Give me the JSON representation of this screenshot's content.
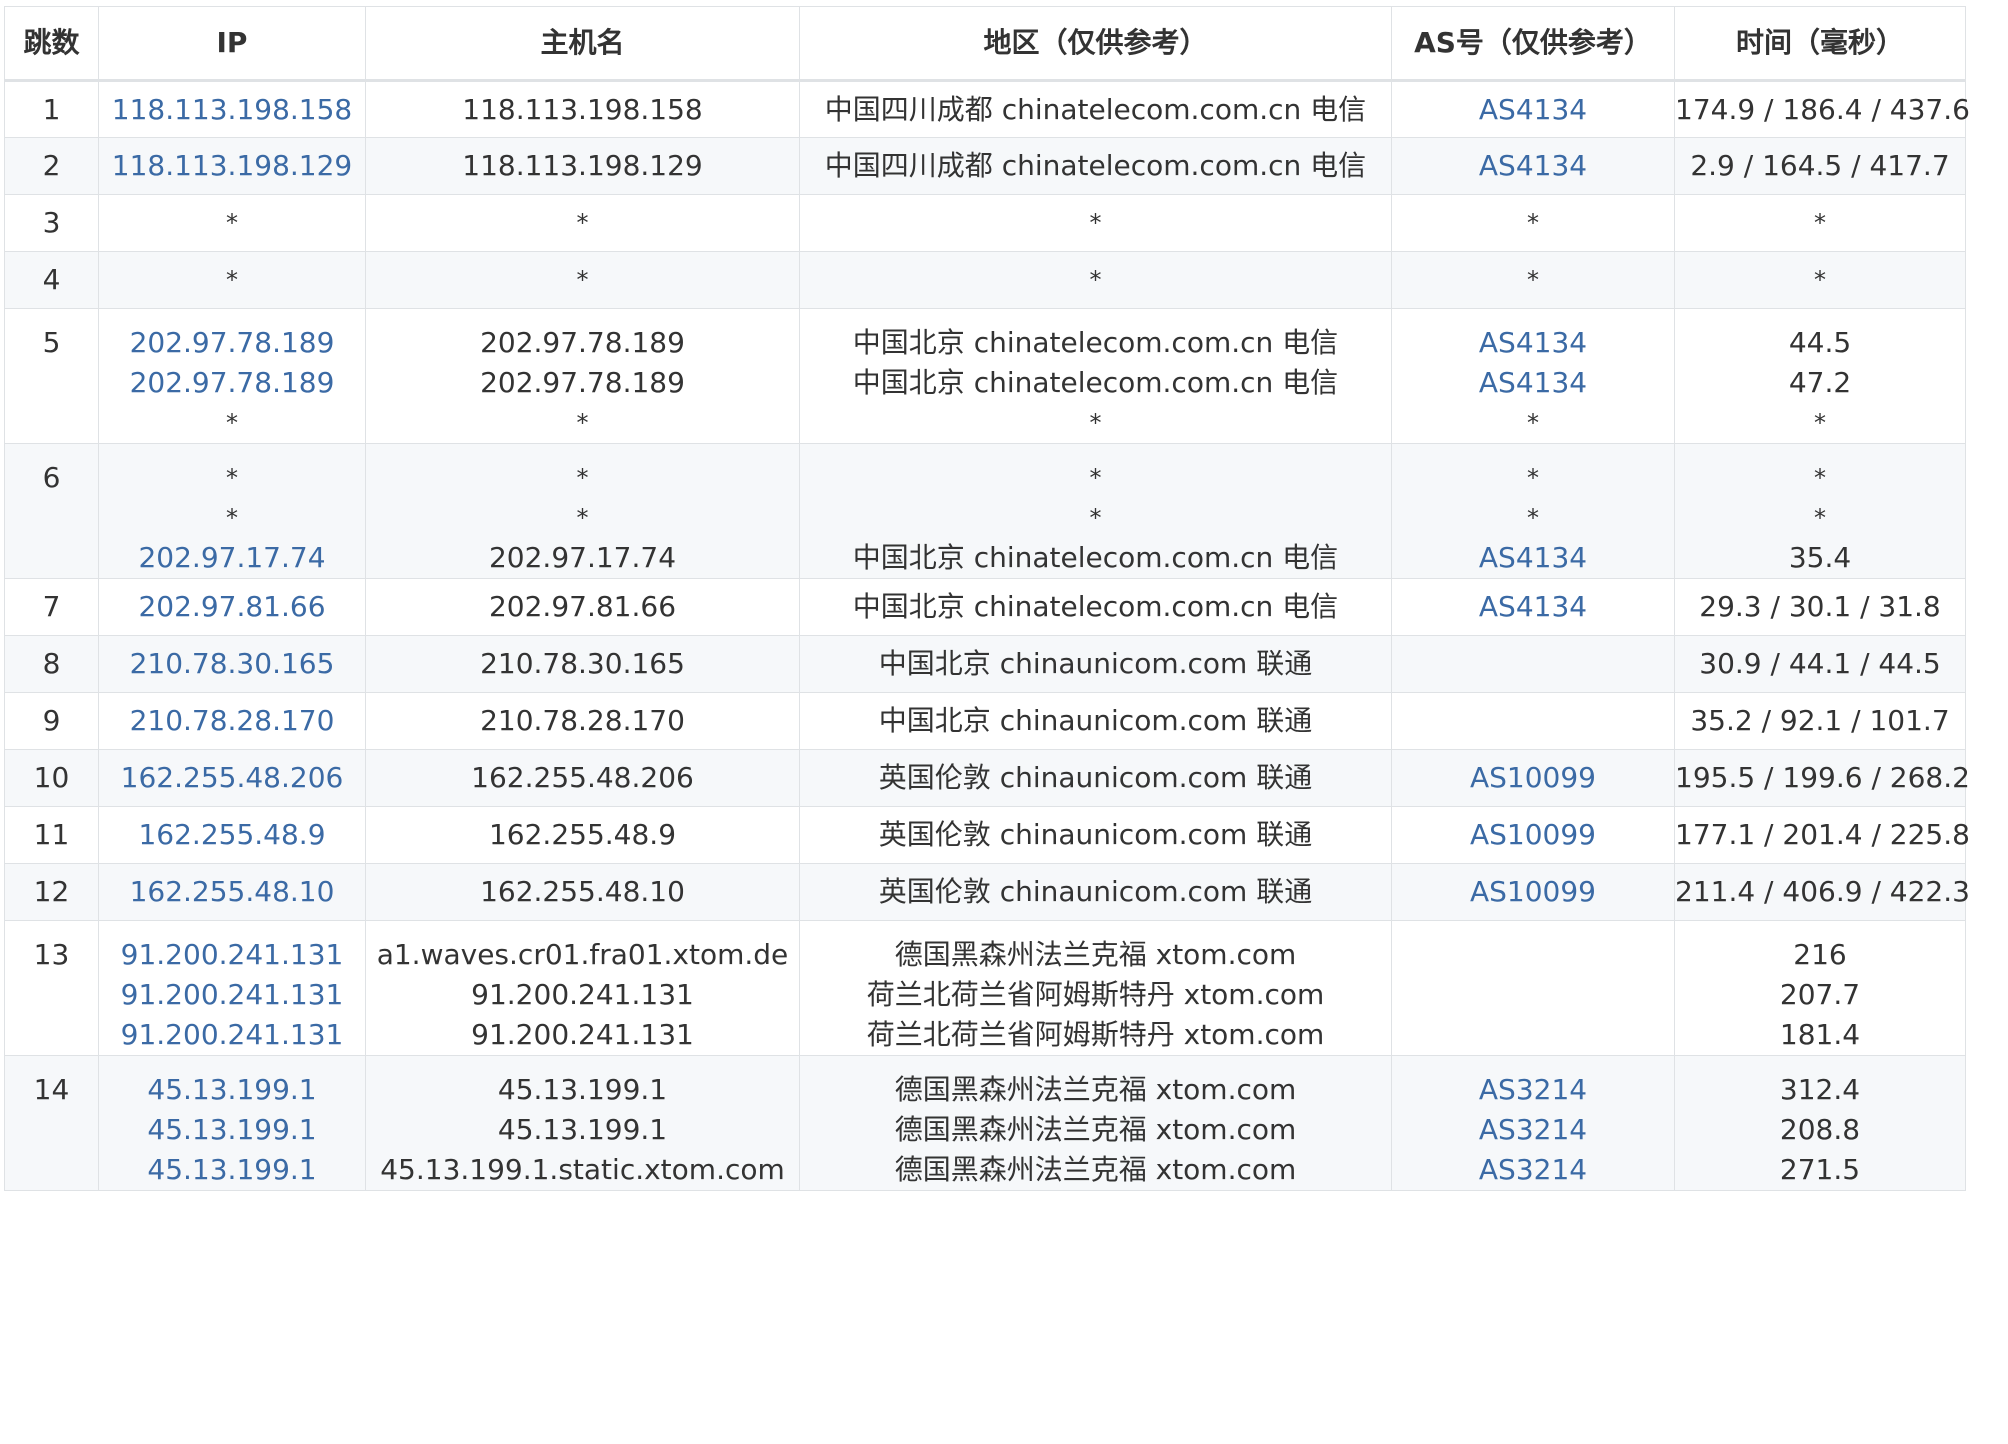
{
  "headers": {
    "hop": "跳数",
    "ip": "IP",
    "host": "主机名",
    "region": "地区（仅供参考）",
    "as": "AS号（仅供参考）",
    "time": "时间（毫秒）"
  },
  "rows": [
    {
      "hop": "1",
      "entries": [
        {
          "ip": "118.113.198.158",
          "host": "118.113.198.158",
          "region": "中国四川成都 chinatelecom.com.cn 电信",
          "as": "AS4134",
          "time": "174.9 / 186.4 / 437.6"
        }
      ]
    },
    {
      "hop": "2",
      "entries": [
        {
          "ip": "118.113.198.129",
          "host": "118.113.198.129",
          "region": "中国四川成都 chinatelecom.com.cn 电信",
          "as": "AS4134",
          "time": "2.9 / 164.5 / 417.7"
        }
      ]
    },
    {
      "hop": "3",
      "entries": [
        {
          "ip": "*",
          "host": "*",
          "region": "*",
          "as": "*",
          "time": "*"
        }
      ]
    },
    {
      "hop": "4",
      "entries": [
        {
          "ip": "*",
          "host": "*",
          "region": "*",
          "as": "*",
          "time": "*"
        }
      ]
    },
    {
      "hop": "5",
      "entries": [
        {
          "ip": "202.97.78.189",
          "host": "202.97.78.189",
          "region": "中国北京 chinatelecom.com.cn 电信",
          "as": "AS4134",
          "time": "44.5"
        },
        {
          "ip": "202.97.78.189",
          "host": "202.97.78.189",
          "region": "中国北京 chinatelecom.com.cn 电信",
          "as": "AS4134",
          "time": "47.2"
        },
        {
          "ip": "*",
          "host": "*",
          "region": "*",
          "as": "*",
          "time": "*"
        }
      ]
    },
    {
      "hop": "6",
      "entries": [
        {
          "ip": "*",
          "host": "*",
          "region": "*",
          "as": "*",
          "time": "*"
        },
        {
          "ip": "*",
          "host": "*",
          "region": "*",
          "as": "*",
          "time": "*"
        },
        {
          "ip": "202.97.17.74",
          "host": "202.97.17.74",
          "region": "中国北京 chinatelecom.com.cn 电信",
          "as": "AS4134",
          "time": "35.4"
        }
      ]
    },
    {
      "hop": "7",
      "entries": [
        {
          "ip": "202.97.81.66",
          "host": "202.97.81.66",
          "region": "中国北京 chinatelecom.com.cn 电信",
          "as": "AS4134",
          "time": "29.3 / 30.1 / 31.8"
        }
      ]
    },
    {
      "hop": "8",
      "entries": [
        {
          "ip": "210.78.30.165",
          "host": "210.78.30.165",
          "region": "中国北京 chinaunicom.com 联通",
          "as": "",
          "time": "30.9 / 44.1 / 44.5"
        }
      ]
    },
    {
      "hop": "9",
      "entries": [
        {
          "ip": "210.78.28.170",
          "host": "210.78.28.170",
          "region": "中国北京 chinaunicom.com 联通",
          "as": "",
          "time": "35.2 / 92.1 / 101.7"
        }
      ]
    },
    {
      "hop": "10",
      "entries": [
        {
          "ip": "162.255.48.206",
          "host": "162.255.48.206",
          "region": "英国伦敦 chinaunicom.com 联通",
          "as": "AS10099",
          "time": "195.5 / 199.6 / 268.2"
        }
      ]
    },
    {
      "hop": "11",
      "entries": [
        {
          "ip": "162.255.48.9",
          "host": "162.255.48.9",
          "region": "英国伦敦 chinaunicom.com 联通",
          "as": "AS10099",
          "time": "177.1 / 201.4 / 225.8"
        }
      ]
    },
    {
      "hop": "12",
      "entries": [
        {
          "ip": "162.255.48.10",
          "host": "162.255.48.10",
          "region": "英国伦敦 chinaunicom.com 联通",
          "as": "AS10099",
          "time": "211.4 / 406.9 / 422.3"
        }
      ]
    },
    {
      "hop": "13",
      "entries": [
        {
          "ip": "91.200.241.131",
          "host": "a1.waves.cr01.fra01.xtom.de",
          "region": "德国黑森州法兰克福 xtom.com",
          "as": "",
          "time": "216"
        },
        {
          "ip": "91.200.241.131",
          "host": "91.200.241.131",
          "region": "荷兰北荷兰省阿姆斯特丹 xtom.com",
          "as": "",
          "time": "207.7"
        },
        {
          "ip": "91.200.241.131",
          "host": "91.200.241.131",
          "region": "荷兰北荷兰省阿姆斯特丹 xtom.com",
          "as": "",
          "time": "181.4"
        }
      ]
    },
    {
      "hop": "14",
      "entries": [
        {
          "ip": "45.13.199.1",
          "host": "45.13.199.1",
          "region": "德国黑森州法兰克福 xtom.com",
          "as": "AS3214",
          "time": "312.4"
        },
        {
          "ip": "45.13.199.1",
          "host": "45.13.199.1",
          "region": "德国黑森州法兰克福 xtom.com",
          "as": "AS3214",
          "time": "208.8"
        },
        {
          "ip": "45.13.199.1",
          "host": "45.13.199.1.static.xtom.com",
          "region": "德国黑森州法兰克福 xtom.com",
          "as": "AS3214",
          "time": "271.5"
        }
      ]
    }
  ],
  "colors": {
    "link": "#3b6aa5",
    "stripe": "#f6f8fa",
    "border": "#dfe2e5",
    "text": "#333333"
  }
}
